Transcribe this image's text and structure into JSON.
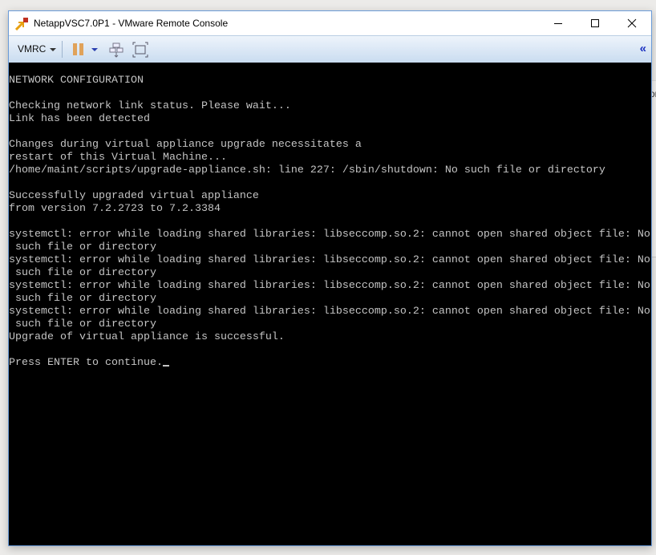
{
  "window": {
    "title": "NetappVSC7.0P1 - VMware Remote Console",
    "controls": {
      "minimize": "minimize-icon",
      "maximize": "maximize-icon",
      "close": "close-icon"
    }
  },
  "toolbar": {
    "vmrc_label": "VMRC",
    "icons": [
      "pause-icon",
      "send-keys-icon",
      "fullscreen-icon",
      "collapse-icon"
    ]
  },
  "background": {
    "partial_text": "or"
  },
  "console": {
    "lines": [
      "NETWORK CONFIGURATION",
      "",
      "Checking network link status. Please wait...",
      "Link has been detected",
      "",
      "Changes during virtual appliance upgrade necessitates a",
      "restart of this Virtual Machine...",
      "/home/maint/scripts/upgrade-appliance.sh: line 227: /sbin/shutdown: No such file or directory",
      "",
      "Successfully upgraded virtual appliance",
      "from version 7.2.2723 to 7.2.3384",
      "",
      "systemctl: error while loading shared libraries: libseccomp.so.2: cannot open shared object file: No",
      " such file or directory",
      "systemctl: error while loading shared libraries: libseccomp.so.2: cannot open shared object file: No",
      " such file or directory",
      "systemctl: error while loading shared libraries: libseccomp.so.2: cannot open shared object file: No",
      " such file or directory",
      "systemctl: error while loading shared libraries: libseccomp.so.2: cannot open shared object file: No",
      " such file or directory",
      "Upgrade of virtual appliance is successful.",
      ""
    ],
    "prompt": "Press ENTER to continue."
  }
}
